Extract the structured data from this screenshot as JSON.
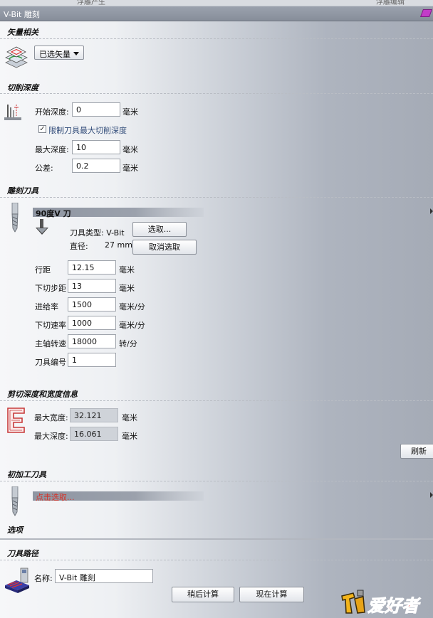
{
  "topstrip": {
    "left_text": "浮雕产生",
    "right_text": "浮雕编辑"
  },
  "window": {
    "title": "V-Bit 雕刻"
  },
  "vector": {
    "heading": "矢量相关",
    "select_label": "已选矢量"
  },
  "depth": {
    "heading": "切削深度",
    "start_label": "开始深度:",
    "start_value": "0",
    "start_unit": "毫米",
    "limit_check": "✓",
    "limit_label": "限制刀具最大切削深度",
    "max_label": "最大深度:",
    "max_value": "10",
    "max_unit": "毫米",
    "tol_label": "公差:",
    "tol_value": "0.2",
    "tol_unit": "毫米"
  },
  "tool": {
    "heading": "雕刻刀具",
    "name": "90度V 刀",
    "type_label": "刀具类型: V-Bit",
    "diameter_label": "直径:",
    "diameter_value": "27 mm",
    "select_button": "选取...",
    "deselect_button": "取消选取",
    "params": [
      {
        "label": "行距",
        "value": "12.15",
        "unit": "毫米"
      },
      {
        "label": "下切步距",
        "value": "13",
        "unit": "毫米"
      },
      {
        "label": "进给率",
        "value": "1500",
        "unit": "毫米/分"
      },
      {
        "label": "下切速率",
        "value": "1000",
        "unit": "毫米/分"
      },
      {
        "label": "主轴转速",
        "value": "18000",
        "unit": "转/分"
      },
      {
        "label": "刀具编号",
        "value": "1",
        "unit": ""
      }
    ]
  },
  "info": {
    "heading": "剪切深度和宽度信息",
    "width_label": "最大宽度:",
    "width_value": "32.121",
    "width_unit": "毫米",
    "depth_label": "最大深度:",
    "depth_value": "16.061",
    "depth_unit": "毫米",
    "refresh_button": "刷新"
  },
  "preclear": {
    "heading": "初加工刀具",
    "select_prompt": "点击选取...",
    "prompt_color": "#d4352b"
  },
  "options": {
    "heading": "选项"
  },
  "toolpath": {
    "heading": "刀具路径",
    "name_label": "名称:",
    "name_value": "V-Bit 雕刻",
    "later_button": "稍后计算",
    "now_button": "现在计算"
  },
  "watermark": {
    "text": "爱好者"
  }
}
